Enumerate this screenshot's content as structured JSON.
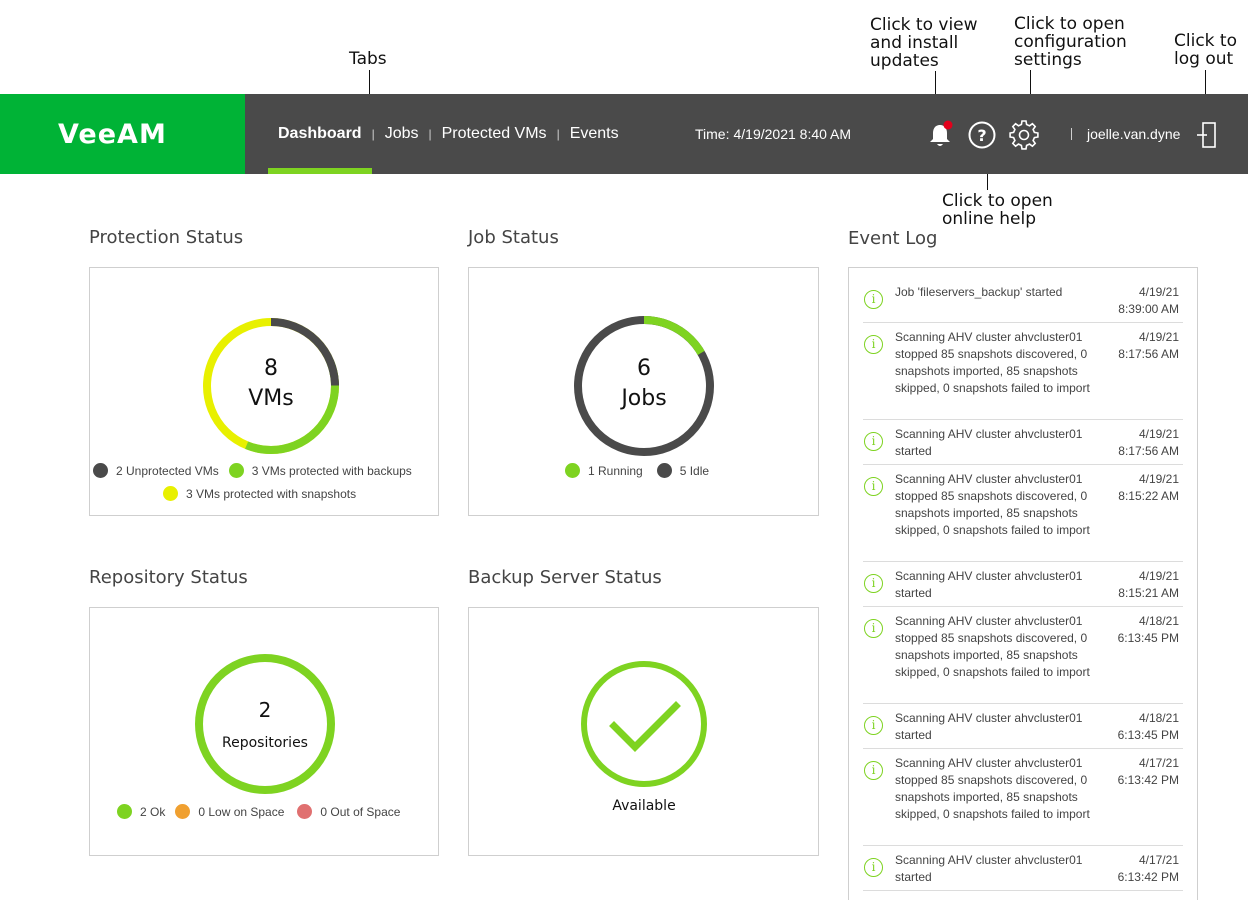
{
  "annotations": {
    "tabs": "Tabs",
    "updates": "Click to view\nand install\nupdates",
    "config": "Click to open\nconfiguration\nsettings",
    "logout": "Click to\nlog out",
    "help": "Click to open\nonline help"
  },
  "header": {
    "logo": "VeeAM",
    "tabs": [
      "Dashboard",
      "Jobs",
      "Protected VMs",
      "Events"
    ],
    "active_tab": "Dashboard",
    "time_label": "Time:",
    "time_value": "4/19/2021 8:40 AM",
    "username": "joelle.van.dyne"
  },
  "icons": {
    "notifications": "bell-icon",
    "help": "help-icon",
    "settings": "gear-icon",
    "logout": "logout-icon"
  },
  "colors": {
    "brand_green": "#00b336",
    "accent_green": "#7ed321",
    "dark_gray": "#4a4a4a",
    "yellow": "#e8f000",
    "orange": "#f0a030",
    "red": "#e07070",
    "notification_dot": "#e3001b"
  },
  "protection_status": {
    "title": "Protection Status",
    "center_value": "8",
    "center_label": "VMs",
    "legend": [
      {
        "label": "2 Unprotected VMs",
        "color": "#4a4a4a",
        "value": 2
      },
      {
        "label": "3 VMs protected with backups",
        "color": "#7ed321",
        "value": 3
      },
      {
        "label": "3 VMs protected with snapshots",
        "color": "#e8f000",
        "value": 3
      }
    ]
  },
  "job_status": {
    "title": "Job Status",
    "center_value": "6",
    "center_label": "Jobs",
    "legend": [
      {
        "label": "1 Running",
        "color": "#7ed321",
        "value": 1
      },
      {
        "label": "5 Idle",
        "color": "#4a4a4a",
        "value": 5
      }
    ]
  },
  "repository_status": {
    "title": "Repository Status",
    "center_value": "2",
    "center_label": "Repositories",
    "legend": [
      {
        "label": "2 Ok",
        "color": "#7ed321",
        "value": 2
      },
      {
        "label": "0 Low on Space",
        "color": "#f0a030",
        "value": 0
      },
      {
        "label": "0 Out of Space",
        "color": "#e07070",
        "value": 0
      }
    ]
  },
  "backup_server_status": {
    "title": "Backup Server Status",
    "status": "Available"
  },
  "event_log": {
    "title": "Event Log",
    "events": [
      {
        "message": "Job 'fileservers_backup' started",
        "date": "4/19/21",
        "time": "8:39:00 AM"
      },
      {
        "message": "Scanning AHV cluster ahvcluster01 stopped 85 snapshots discovered, 0 snapshots imported, 85 snapshots skipped, 0 snapshots failed to import",
        "date": "4/19/21",
        "time": "8:17:56 AM"
      },
      {
        "message": "Scanning AHV cluster ahvcluster01 started",
        "date": "4/19/21",
        "time": "8:17:56 AM"
      },
      {
        "message": "Scanning AHV cluster ahvcluster01 stopped 85 snapshots discovered, 0 snapshots imported, 85 snapshots skipped, 0 snapshots failed to import",
        "date": "4/19/21",
        "time": "8:15:22 AM"
      },
      {
        "message": "Scanning AHV cluster ahvcluster01 started",
        "date": "4/19/21",
        "time": "8:15:21 AM"
      },
      {
        "message": "Scanning AHV cluster ahvcluster01 stopped 85 snapshots discovered, 0 snapshots imported, 85 snapshots skipped, 0 snapshots failed to import",
        "date": "4/18/21",
        "time": "6:13:45 PM"
      },
      {
        "message": "Scanning AHV cluster ahvcluster01 started",
        "date": "4/18/21",
        "time": "6:13:45 PM"
      },
      {
        "message": "Scanning AHV cluster ahvcluster01 stopped 85 snapshots discovered, 0 snapshots imported, 85 snapshots skipped, 0 snapshots failed to import",
        "date": "4/17/21",
        "time": "6:13:42 PM"
      },
      {
        "message": "Scanning AHV cluster ahvcluster01 started",
        "date": "4/17/21",
        "time": "6:13:42 PM"
      }
    ]
  }
}
